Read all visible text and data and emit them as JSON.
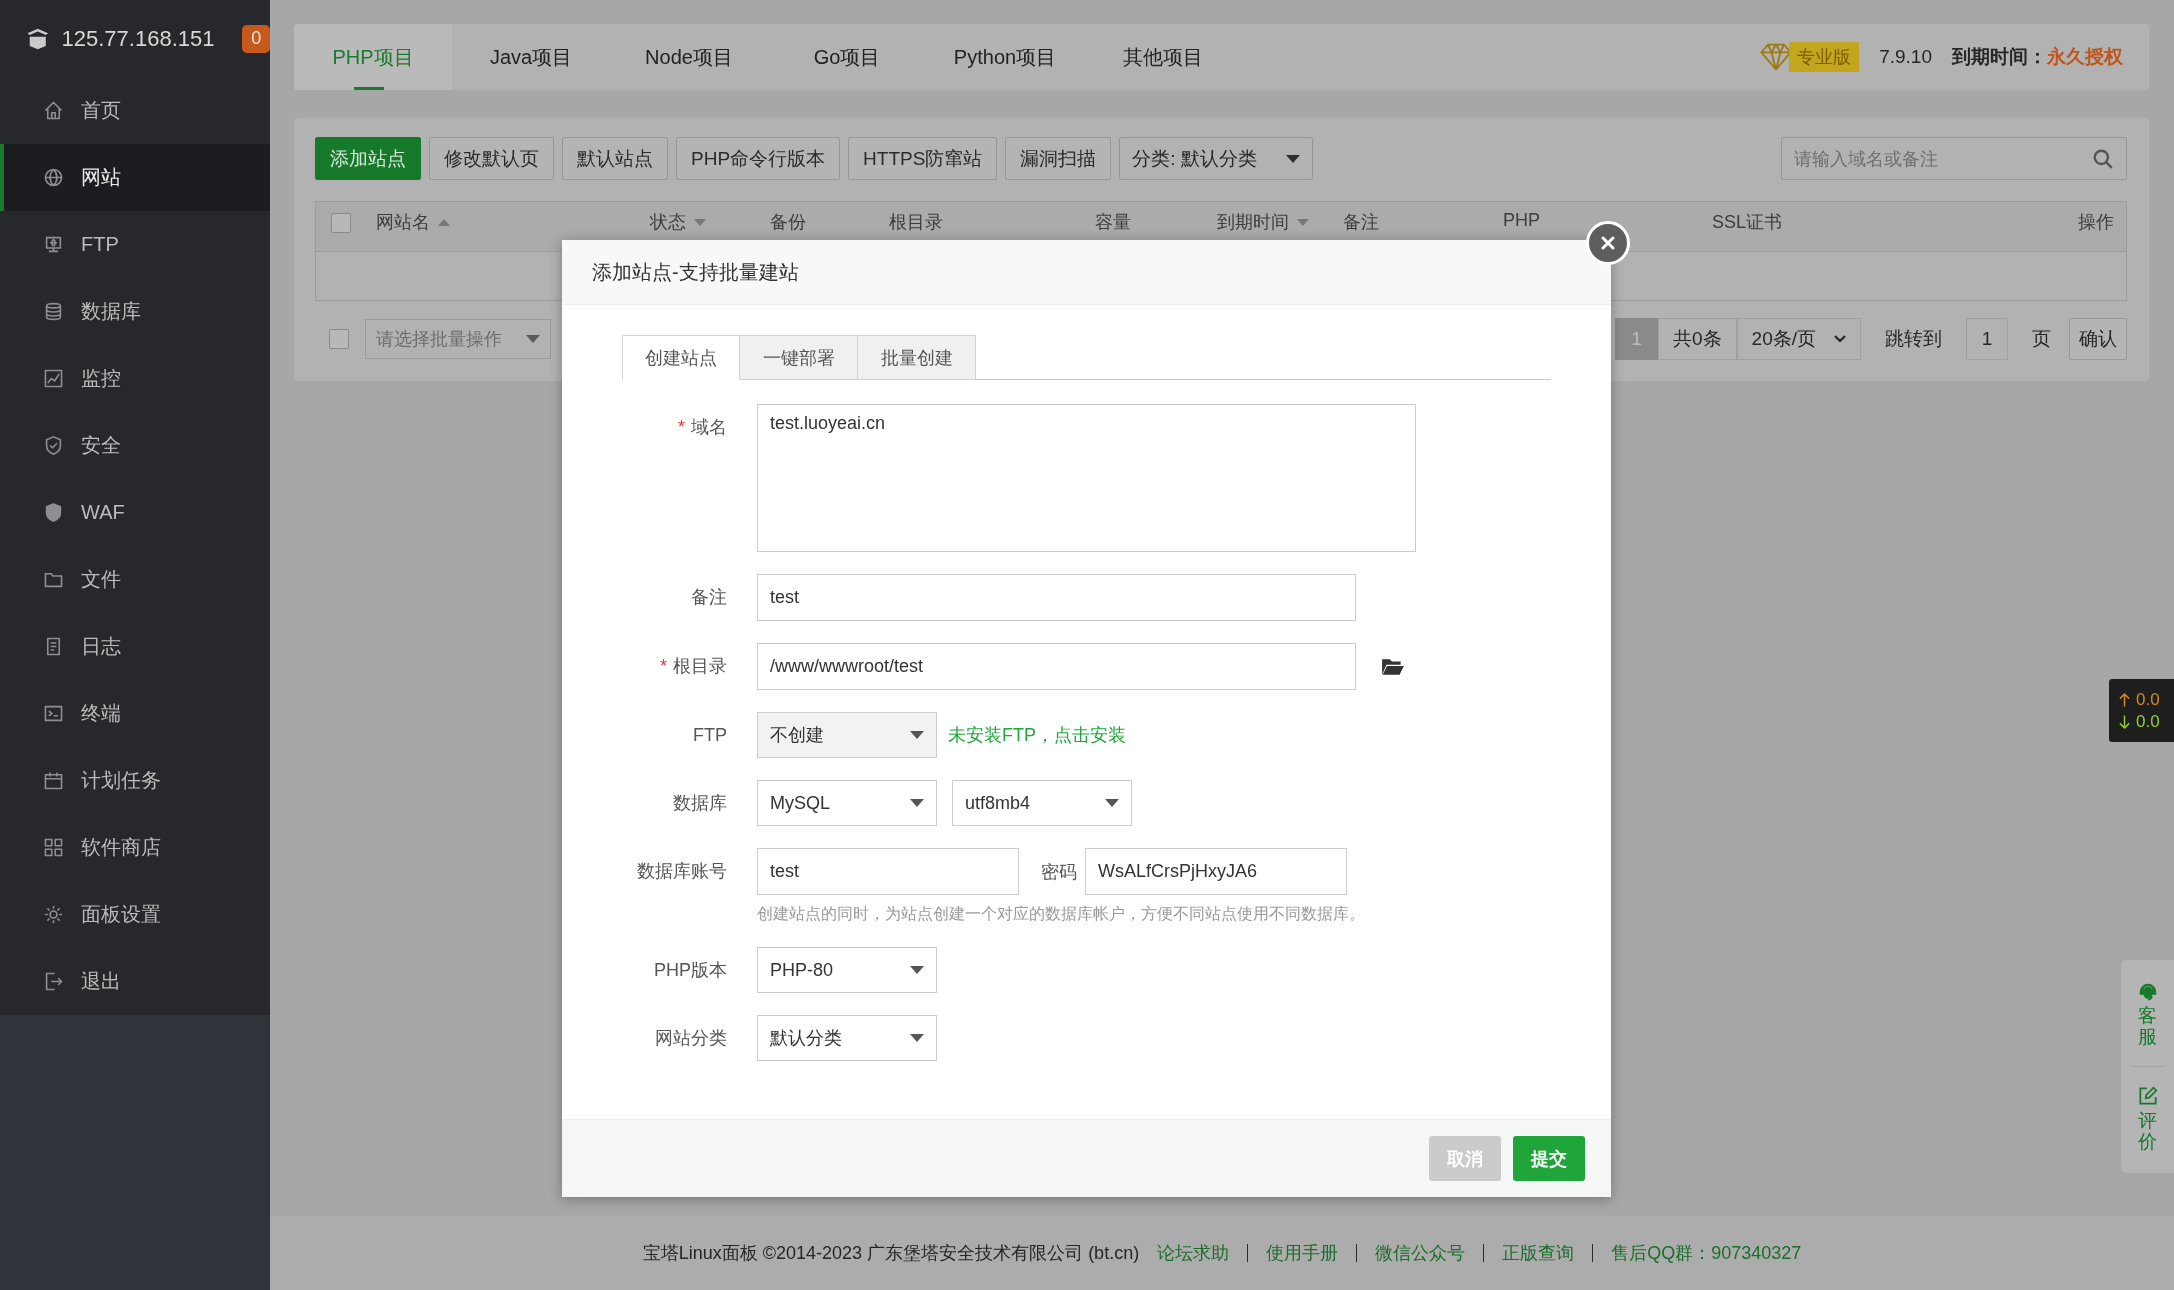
{
  "sidebar": {
    "server": "125.77.168.151",
    "badge": "0",
    "items": [
      {
        "label": "首页",
        "selected": false
      },
      {
        "label": "网站",
        "selected": true
      },
      {
        "label": "FTP",
        "selected": false
      },
      {
        "label": "数据库",
        "selected": false
      },
      {
        "label": "监控",
        "selected": false
      },
      {
        "label": "安全",
        "selected": false
      },
      {
        "label": "WAF",
        "selected": false
      },
      {
        "label": "文件",
        "selected": false
      },
      {
        "label": "日志",
        "selected": false
      },
      {
        "label": "终端",
        "selected": false
      },
      {
        "label": "计划任务",
        "selected": false
      },
      {
        "label": "软件商店",
        "selected": false
      },
      {
        "label": "面板设置",
        "selected": false
      },
      {
        "label": "退出",
        "selected": false
      }
    ]
  },
  "project_tabs": [
    {
      "label": "PHP项目",
      "selected": true
    },
    {
      "label": "Java项目",
      "selected": false
    },
    {
      "label": "Node项目",
      "selected": false
    },
    {
      "label": "Go项目",
      "selected": false
    },
    {
      "label": "Python项目",
      "selected": false
    },
    {
      "label": "其他项目",
      "selected": false
    }
  ],
  "license": {
    "edition": "专业版",
    "version": "7.9.10",
    "expiry_label": "到期时间：",
    "expiry_value": "永久授权"
  },
  "toolbar": {
    "buttons": [
      {
        "label": "添加站点",
        "kind": "primary"
      },
      {
        "label": "修改默认页",
        "kind": "default"
      },
      {
        "label": "默认站点",
        "kind": "default"
      },
      {
        "label": "PHP命令行版本",
        "kind": "default"
      },
      {
        "label": "HTTPS防窜站",
        "kind": "default"
      },
      {
        "label": "漏洞扫描",
        "kind": "default"
      }
    ],
    "category": "分类: 默认分类",
    "search": {
      "placeholder": "请输入域名或备注"
    }
  },
  "table": {
    "select_all": {
      "checked": false
    },
    "columns": [
      {
        "label": "网站名",
        "sortable": true,
        "ascending": true
      },
      {
        "label": "状态",
        "sortable": true,
        "ascending": false
      },
      {
        "label": "备份",
        "sortable": false
      },
      {
        "label": "根目录",
        "sortable": false
      },
      {
        "label": "容量",
        "sortable": false
      },
      {
        "label": "到期时间",
        "sortable": true,
        "ascending": false
      },
      {
        "label": "备注",
        "sortable": false
      },
      {
        "label": "PHP",
        "sortable": false
      },
      {
        "label": "SSL证书",
        "sortable": false
      },
      {
        "label": "操作",
        "sortable": false
      }
    ],
    "bulk": {
      "checked": false,
      "placeholder": "请选择批量操作"
    },
    "pagination": {
      "current": "1",
      "total": "共0条",
      "page_size": "20条/页",
      "jump_label": "跳转到",
      "jump_value": "1",
      "page_unit": "页",
      "confirm": "确认"
    }
  },
  "dialog": {
    "title": "添加站点-支持批量建站",
    "tabs": [
      {
        "label": "创建站点",
        "selected": true
      },
      {
        "label": "一键部署",
        "selected": false
      },
      {
        "label": "批量创建",
        "selected": false
      }
    ],
    "form": [
      {
        "kind": "textarea",
        "label": "域名",
        "mark": "*",
        "value": "test.luoyeai.cn"
      },
      {
        "kind": "input",
        "label": "备注",
        "value": "test"
      },
      {
        "kind": "path",
        "label": "根目录",
        "mark": "*",
        "value": "/www/wwwroot/test"
      },
      {
        "kind": "select_link",
        "label": "FTP",
        "selects": [
          {
            "value": "不创建",
            "disabled": true
          }
        ],
        "link": "未安装FTP，点击安装"
      },
      {
        "kind": "selects",
        "label": "数据库",
        "selects": [
          {
            "value": "MySQL",
            "disabled": false
          },
          {
            "value": "utf8mb4",
            "disabled": false
          }
        ]
      },
      {
        "kind": "account",
        "label": "数据库账号",
        "value": "test",
        "password_label": "密码",
        "password": "WsALfCrsPjHxyJA6",
        "hint": "创建站点的同时，为站点创建一个对应的数据库帐户，方便不同站点使用不同数据库。"
      },
      {
        "kind": "selects",
        "label": "PHP版本",
        "selects": [
          {
            "value": "PHP-80",
            "disabled": false
          }
        ]
      },
      {
        "kind": "selects",
        "label": "网站分类",
        "selects": [
          {
            "value": "默认分类",
            "disabled": false
          }
        ]
      }
    ],
    "buttons": [
      {
        "label": "取消",
        "kind": "cancel"
      },
      {
        "label": "提交",
        "kind": "submit"
      }
    ]
  },
  "footer": {
    "copyright": "宝塔Linux面板 ©2014-2023 广东堡塔安全技术有限公司 (bt.cn)",
    "links": [
      "论坛求助",
      "使用手册",
      "微信公众号",
      "正版查询",
      "售后QQ群：907340327"
    ]
  },
  "net_speed": {
    "up": "0.0",
    "down": "0.0"
  },
  "side_panel": [
    {
      "label": "客服"
    },
    {
      "label": "评价"
    }
  ]
}
